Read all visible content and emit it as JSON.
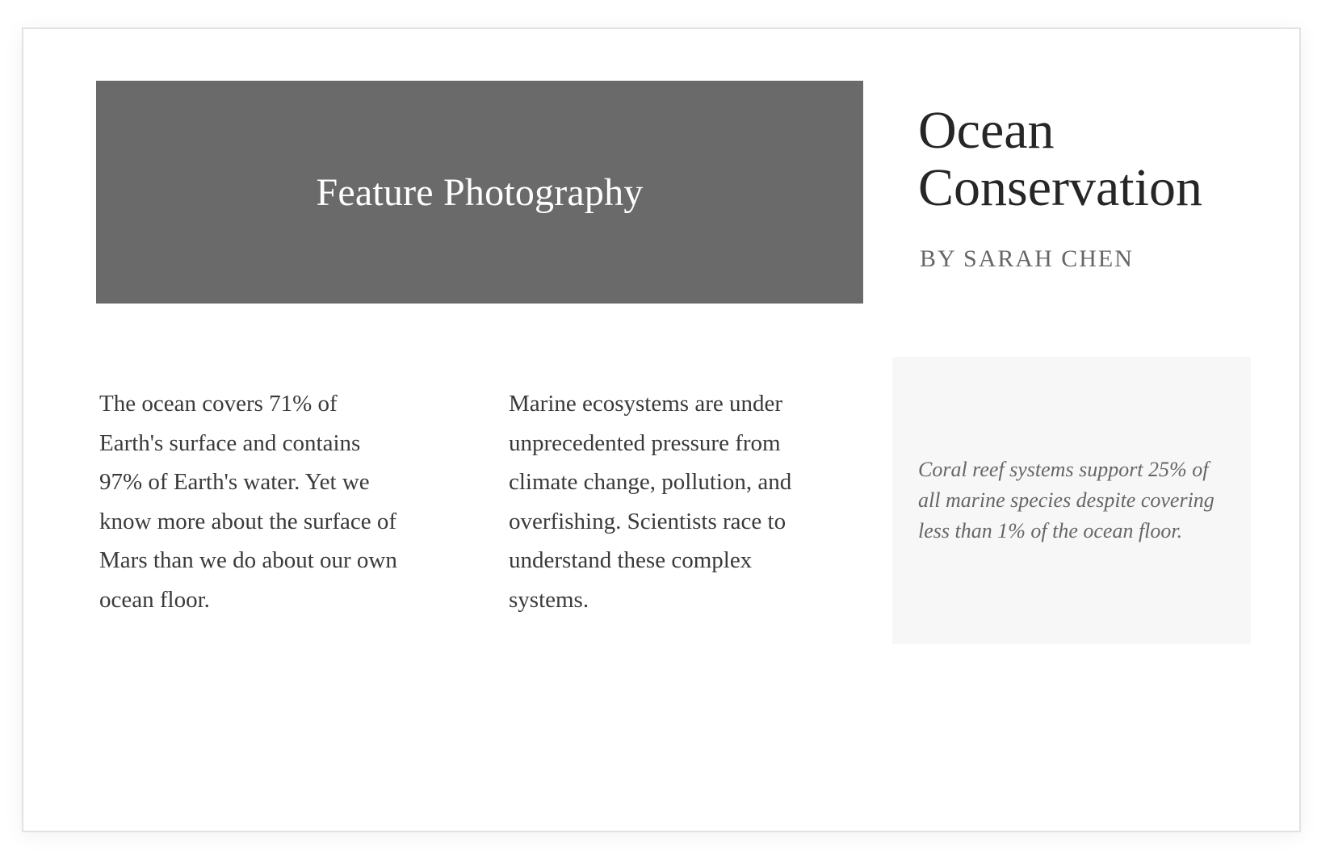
{
  "feature": {
    "label": "Feature Photography"
  },
  "article": {
    "title": "Ocean Conservation",
    "byline": "BY SARAH CHEN",
    "columns": [
      "The ocean covers 71% of Earth's surface and contains 97% of Earth's water. Yet we know more about the surface of Mars than we do about our own ocean floor.",
      "Marine ecosystems are under unprecedented pressure from climate change, pollution, and overfishing. Scientists race to understand these complex systems."
    ],
    "sidebar_quote": "Coral reef systems support 25% of all marine species despite covering less than 1% of the ocean floor."
  }
}
